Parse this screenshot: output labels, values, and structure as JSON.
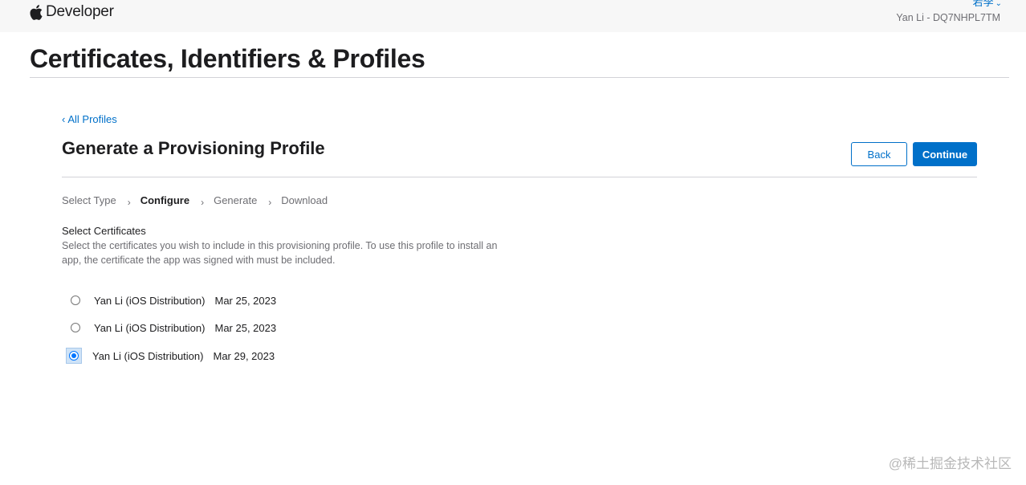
{
  "header": {
    "brand_text": "Developer",
    "user_name": "若李",
    "team": "Yan Li - DQ7NHPL7TM"
  },
  "page": {
    "title": "Certificates, Identifiers & Profiles"
  },
  "section": {
    "back_link": "All Profiles",
    "title": "Generate a Provisioning Profile",
    "back_button": "Back",
    "continue_button": "Continue"
  },
  "steps": [
    {
      "label": "Select Type",
      "active": false
    },
    {
      "label": "Configure",
      "active": true
    },
    {
      "label": "Generate",
      "active": false
    },
    {
      "label": "Download",
      "active": false
    }
  ],
  "certificates": {
    "heading": "Select Certificates",
    "description_line1": "Select the certificates you wish to include in this provisioning profile. To use this profile to install an",
    "description_line2": "app, the certificate the app was signed with must be included.",
    "items": [
      {
        "name": "Yan Li (iOS Distribution)",
        "date": "Mar 25, 2023",
        "selected": false
      },
      {
        "name": "Yan Li (iOS Distribution)",
        "date": "Mar 25, 2023",
        "selected": false
      },
      {
        "name": "Yan Li (iOS Distribution)",
        "date": "Mar 29, 2023",
        "selected": true
      }
    ]
  },
  "watermark": "@稀土掘金技术社区",
  "colors": {
    "accent": "#0070c9",
    "radio_checked": "#0075ff",
    "topbar_bg": "#f7f7f7",
    "divider": "#d2d2d7"
  }
}
